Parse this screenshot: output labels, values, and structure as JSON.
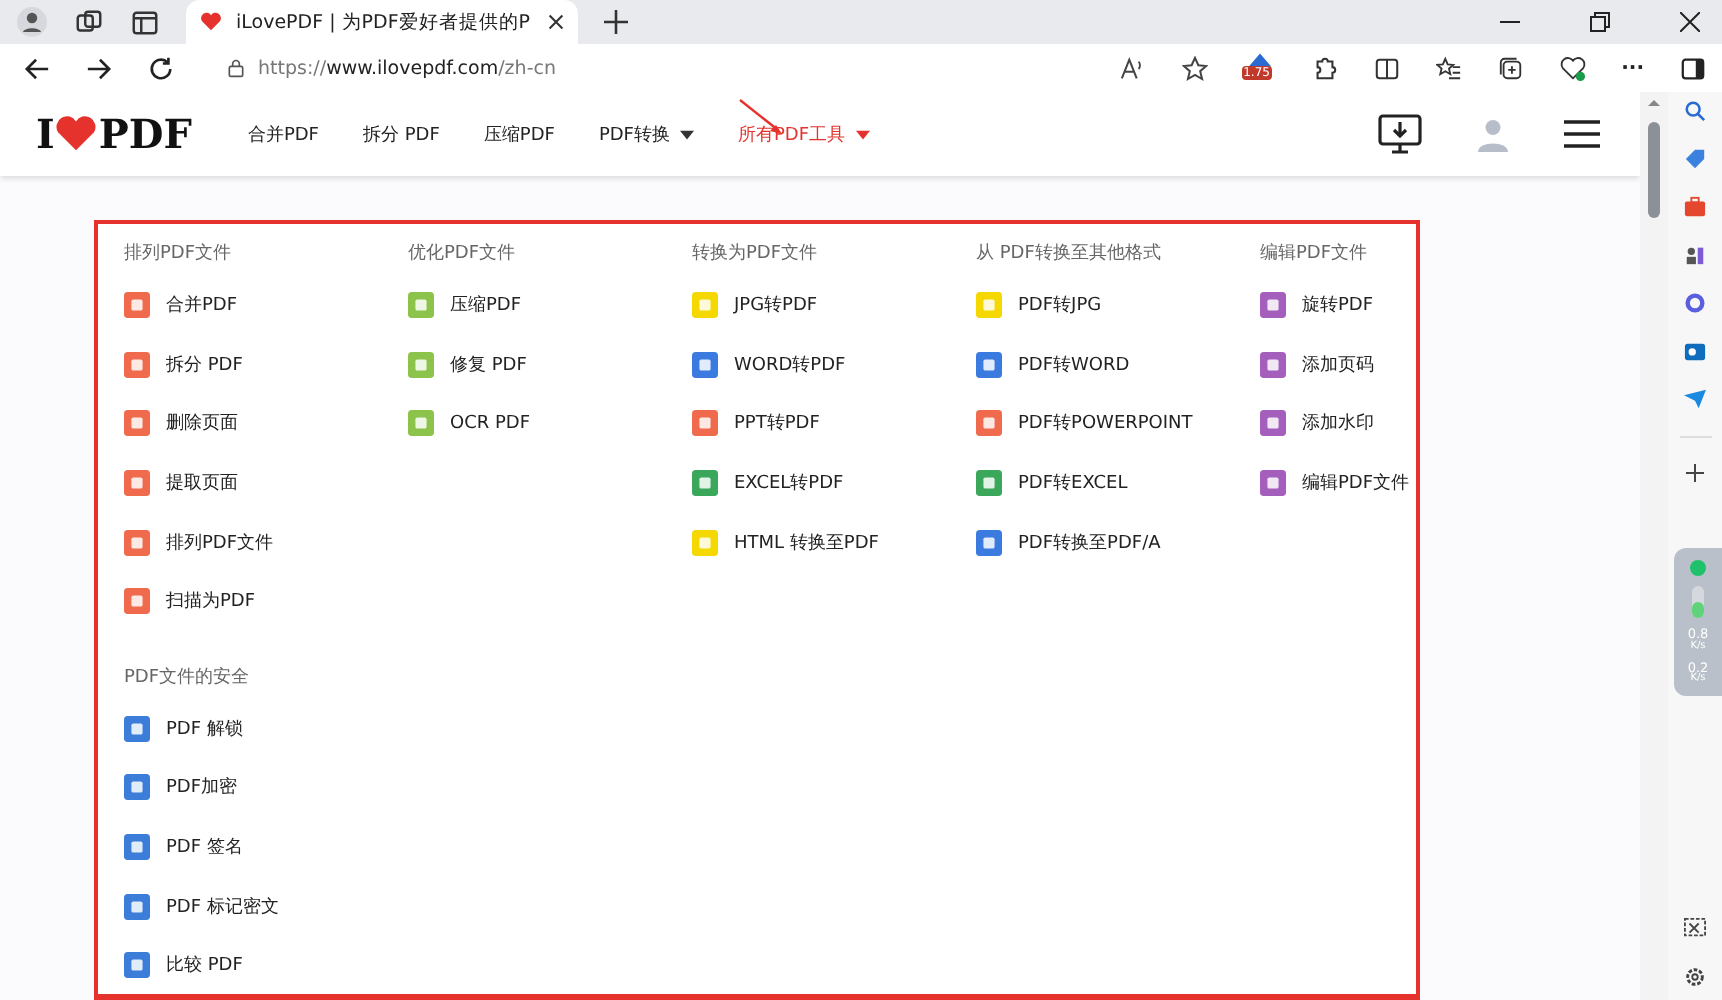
{
  "browser": {
    "tab_title": "iLovePDF | 为PDF爱好者提供的P",
    "url_scheme": "https://",
    "url_host": "www.ilovepdf.com",
    "url_path": "/zh-cn",
    "extension_badge": "1.75",
    "more": "···"
  },
  "header": {
    "logo_left": "I",
    "logo_right": "PDF",
    "nav": [
      {
        "label": "合并PDF",
        "selected": false,
        "dropdown": false
      },
      {
        "label": "拆分 PDF",
        "selected": false,
        "dropdown": false
      },
      {
        "label": "压缩PDF",
        "selected": false,
        "dropdown": false
      },
      {
        "label": "PDF转换",
        "selected": false,
        "dropdown": true
      },
      {
        "label": "所有PDF工具",
        "selected": true,
        "dropdown": true
      }
    ]
  },
  "categories": [
    {
      "title": "排列PDF文件",
      "items": [
        {
          "label": "合并PDF",
          "color": "#f06b4d"
        },
        {
          "label": "拆分 PDF",
          "color": "#f06b4d"
        },
        {
          "label": "删除页面",
          "color": "#f06b4d"
        },
        {
          "label": "提取页面",
          "color": "#f06b4d"
        },
        {
          "label": "排列PDF文件",
          "color": "#f06b4d"
        },
        {
          "label": "扫描为PDF",
          "color": "#f06b4d"
        }
      ]
    },
    {
      "title": "优化PDF文件",
      "items": [
        {
          "label": "压缩PDF",
          "color": "#8cc34b"
        },
        {
          "label": "修复 PDF",
          "color": "#8cc34b"
        },
        {
          "label": "OCR PDF",
          "color": "#8cc34b"
        }
      ]
    },
    {
      "title": "转换为PDF文件",
      "items": [
        {
          "label": "JPG转PDF",
          "color": "#f5d800"
        },
        {
          "label": "WORD转PDF",
          "color": "#3b7be0"
        },
        {
          "label": "PPT转PDF",
          "color": "#f06b4d"
        },
        {
          "label": "EXCEL转PDF",
          "color": "#3aa75a"
        },
        {
          "label": "HTML 转换至PDF",
          "color": "#f5d800"
        }
      ]
    },
    {
      "title": "从 PDF转换至其他格式",
      "items": [
        {
          "label": "PDF转JPG",
          "color": "#f5d800"
        },
        {
          "label": "PDF转WORD",
          "color": "#3b7be0"
        },
        {
          "label": "PDF转POWERPOINT",
          "color": "#f06b4d"
        },
        {
          "label": "PDF转EXCEL",
          "color": "#3aa75a"
        },
        {
          "label": "PDF转换至PDF/A",
          "color": "#3b7be0"
        }
      ]
    },
    {
      "title": "编辑PDF文件",
      "items": [
        {
          "label": "旋转PDF",
          "color": "#a45fbd"
        },
        {
          "label": "添加页码",
          "color": "#a45fbd"
        },
        {
          "label": "添加水印",
          "color": "#a45fbd"
        },
        {
          "label": "编辑PDF文件",
          "color": "#a45fbd"
        }
      ]
    },
    {
      "title": "PDF文件的安全",
      "items": [
        {
          "label": "PDF 解锁",
          "color": "#3b7dd8"
        },
        {
          "label": "PDF加密",
          "color": "#3b7dd8"
        },
        {
          "label": "PDF 签名",
          "color": "#3b7dd8"
        },
        {
          "label": "PDF 标记密文",
          "color": "#3b7dd8"
        },
        {
          "label": "比较 PDF",
          "color": "#3b7dd8"
        }
      ]
    }
  ],
  "side_widget": {
    "readings": [
      {
        "value": "0.8",
        "unit": "K/s"
      },
      {
        "value": "0.2",
        "unit": "K/s"
      }
    ]
  }
}
